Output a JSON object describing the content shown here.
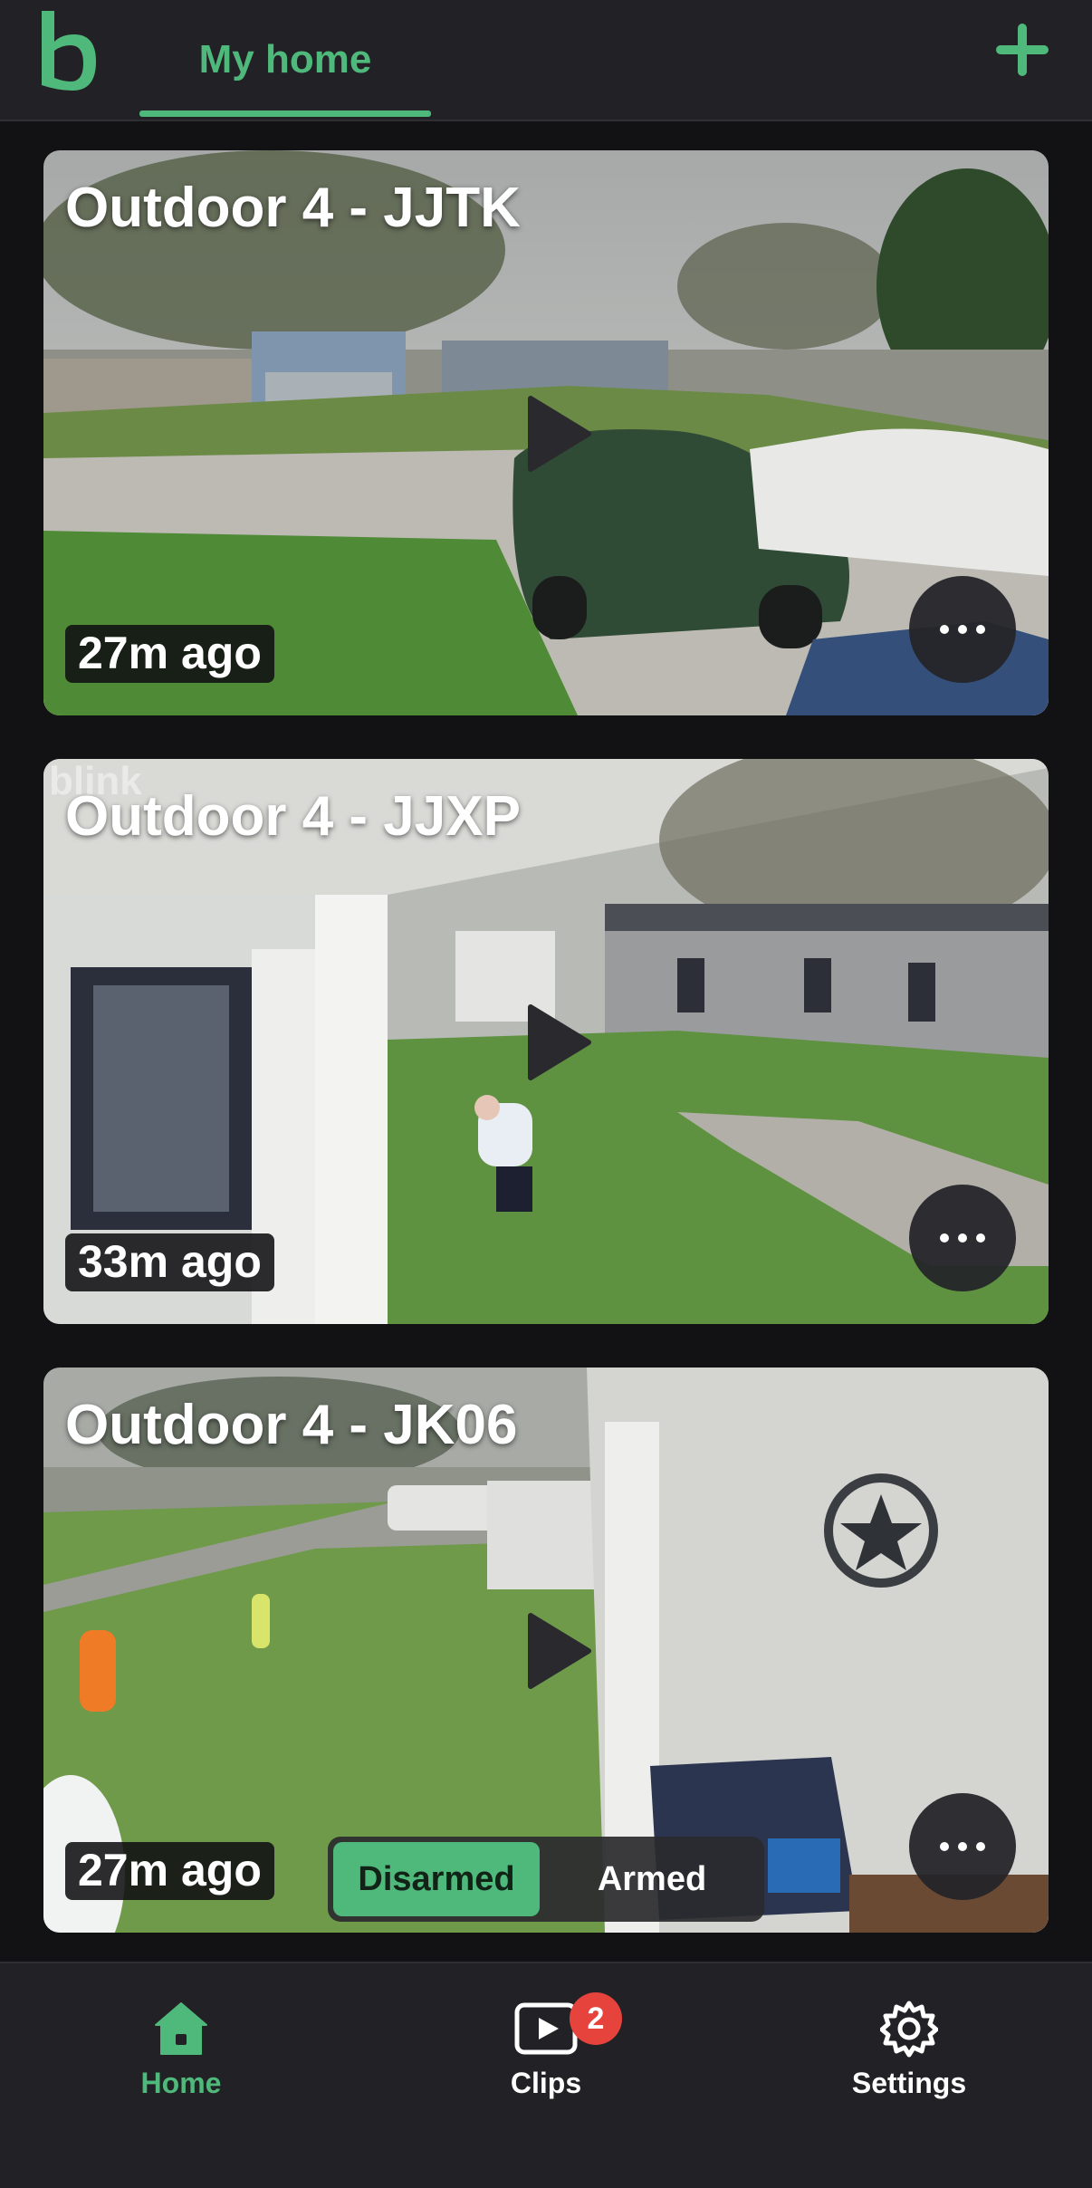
{
  "header": {
    "logo_glyph": "b",
    "tab_label": "My home",
    "accent_color": "#4fb97b",
    "add_icon": "plus-icon"
  },
  "cameras": [
    {
      "title": "Outdoor 4 - JJTK",
      "timestamp": "27m ago"
    },
    {
      "title": "Outdoor 4 - JJXP",
      "timestamp": "33m ago",
      "watermark": "blink"
    },
    {
      "title": "Outdoor 4 - JK06",
      "timestamp": "27m ago"
    }
  ],
  "arm_toggle": {
    "disarmed_label": "Disarmed",
    "armed_label": "Armed",
    "selected": "Disarmed"
  },
  "nav": {
    "home_label": "Home",
    "clips_label": "Clips",
    "clips_badge": "2",
    "settings_label": "Settings",
    "badge_color": "#e5433c"
  }
}
